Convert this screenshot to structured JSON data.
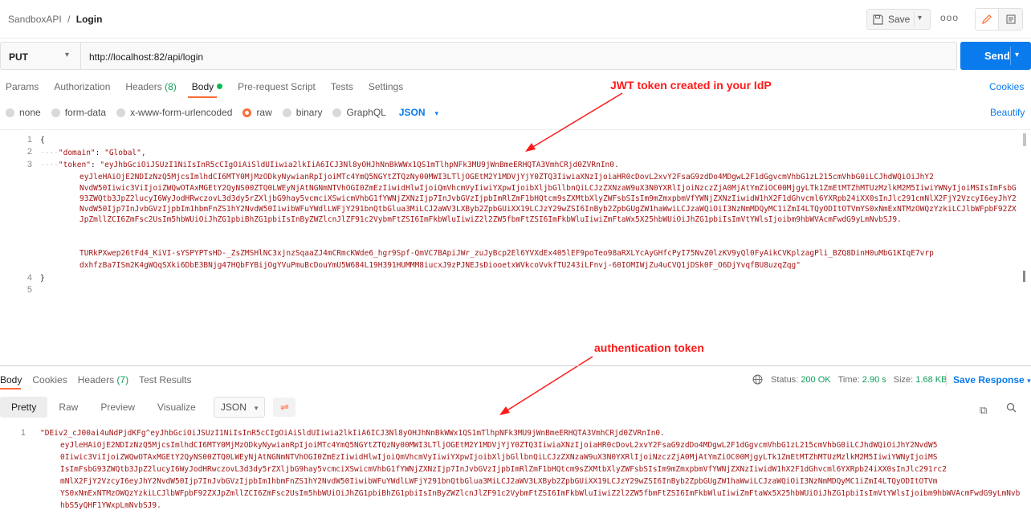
{
  "header": {
    "workspace": "SandboxAPI",
    "separator": "/",
    "request_name": "Login",
    "save_label": "Save",
    "more": "ooo"
  },
  "request": {
    "method": "PUT",
    "url": "http://localhost:82/api/login",
    "send_label": "Send"
  },
  "request_tabs": [
    {
      "label": "Params"
    },
    {
      "label": "Authorization"
    },
    {
      "label": "Headers",
      "count": "(8)"
    },
    {
      "label": "Body"
    },
    {
      "label": "Pre-request Script"
    },
    {
      "label": "Tests"
    },
    {
      "label": "Settings"
    }
  ],
  "cookies_label": "Cookies",
  "body_types": [
    {
      "label": "none"
    },
    {
      "label": "form-data"
    },
    {
      "label": "x-www-form-urlencoded"
    },
    {
      "label": "raw"
    },
    {
      "label": "binary"
    },
    {
      "label": "GraphQL"
    }
  ],
  "body_format": "JSON",
  "beautify_label": "Beautify",
  "editor": {
    "line_numbers": [
      "1",
      "2",
      "3",
      "4",
      "5"
    ],
    "open_brace": "{",
    "close_brace": "}",
    "domain_key": "\"domain\"",
    "domain_value": "\"Global\",",
    "token_key": "\"token\"",
    "token_lines": [
      "\"eyJhbGciOiJSUzI1NiIsInR5cCIgOiAiSldUIiwia2lkIiA6ICJ3Nl8yOHJhNnBkWWx1QS1mTlhpNFk3MU9jWnBmeERHQTA3VmhCRjd0ZVRnIn0.",
      "eyJleHAiOjE2NDIzNzQ5MjcsImlhdCI6MTY0MjMzODkyNywianRpIjoiMTc4YmQ5NGYtZTQzNy00MWI3LTljOGEtM2Y1MDVjYjY0ZTQ3IiwiaXNzIjoiaHR0cDovL2xvY2FsaG9zdDo4MDgwL2F1dGgvcmVhbG1zL215cmVhbG0iLCJhdWQiOiJhY2",
      "NvdW50Iiwic3ViIjoiZWQwOTAxMGEtY2QyNS00ZTQ0LWEyNjAtNGNmNTVhOGI0ZmEzIiwidHlwIjoiQmVhcmVyIiwiYXpwIjoibXljbGllbnQiLCJzZXNzaW9uX3N0YXRlIjoiNzczZjA0MjAtYmZiOC00MjgyLTk1ZmEtMTZhMTUzMzlkM2M5IiwiYWNyIjoiMSIsImFsbG93ZWQtb3JpZ2lucyI6WyJodHRwczovL3d3dy5rZXljbG9hay5vcmciXSwicmVhbG1fYWNjZXNzIjp7InJvbGVzIjpbImRlZmF1bHQtcm9sZXMtbXlyZWFsbSIsIm9mZmxpbmVfYWNjZXNzIiwidW1hX2F1dGhvcml6YXRpb24iXX0sInJlc291cmNlX2FjY2VzcyI6eyJhY2NvdW50Ijp7InJvbGVzIjpbIm1hbmFnZS1hY2NvdW50IiwibWFuYWdlLWFjY291bnQtbGlua3MiLCJ2aWV3LXByb2ZpbGUiXX19LCJzY29wZSI6InByb2ZpbGUgZW1haWwiLCJzaWQiOiI3NzNmMDQyMC1iZmI4LTQyODItOTVmYS0xNmExNTMzOWQzYzkiLCJlbWFpbF92ZXJpZmllZCI6ZmFsc2UsIm5hbWUiOiJhZG1pbiBhZG1pbiIsInByZWZlcnJlZF91c2VybmFtZSI6ImFkbWluIiwiZ2l2ZW5fbmFtZSI6ImFkbWluIiwiZmFtaWx5X25hbWUiOiJhZG1pbiIsImVtYWlsIjoibm9hbWVAcmFwdG9yLmNvbSJ9.",
      "TURkPXwep26tFd4_KiVI-sYSPYPTsHD-_ZsZMSHlNC3xjnzSqaaZJ4mCRmcKWde6_hgr9Spf-QmVC7BApiJWr_zuJyBcp2El6YVXdEx405lEF9poTeo98aRXLYcAyGHfcPyI75NvZ0lzKV9yQl0FyAikCVKplzagPli_BZQ8DinH0uMbG1KIqE7vrp",
      "dxhfzBa7ISm2K4gWQqSXki6DbE3BNjg47HQbFYBijOgYVuPmuBcDouYmU5W684L19H391HUMMM8iucxJ9zPJNEJsDiooetxWVkcoVvkfTU243iLFnvj-60IOMIWjZu4uCVQ1jDSk0F_O6DjYvqfBU8uzqZqg\""
    ]
  },
  "annotations": {
    "jwt": "JWT token created in your IdP",
    "auth": "authentication token"
  },
  "response": {
    "tabs": [
      {
        "label": "Body"
      },
      {
        "label": "Cookies"
      },
      {
        "label": "Headers",
        "count": "(7)"
      },
      {
        "label": "Test Results"
      }
    ],
    "status_label": "Status:",
    "status_value": "200 OK",
    "time_label": "Time:",
    "time_value": "2.90 s",
    "size_label": "Size:",
    "size_value": "1.68 KB",
    "save_response": "Save Response",
    "views": [
      "Pretty",
      "Raw",
      "Preview",
      "Visualize"
    ],
    "format": "JSON",
    "line_number": "1",
    "body_lines": [
      "\"DEiv2_cJ00ai4uNdPjdKFg^eyJhbGciOiJSUzI1NiIsInR5cCIgOiAiSldUIiwia2lkIiA6ICJ3Nl8yOHJhNnBkWWx1QS1mTlhpNFk3MU9jWnBmeERHQTA3VmhCRjd0ZVRnIn0.",
      "eyJleHAiOjE2NDIzNzQ5MjcsImlhdCI6MTY0MjMzODkyNywianRpIjoiMTc4YmQ5NGYtZTQzNy00MWI3LTljOGEtM2Y1MDVjYjY0ZTQ3IiwiaXNzIjoiaHR0cDovL2xvY2FsaG9zdDo4MDgwL2F1dGgvcmVhbG1zL215cmVhbG0iLCJhdWQiOiJhY2NvdW5",
      "0Iiwic3ViIjoiZWQwOTAxMGEtY2QyNS00ZTQ0LWEyNjAtNGNmNTVhOGI0ZmEzIiwidHlwIjoiQmVhcmVyIiwiYXpwIjoibXljbGllbnQiLCJzZXNzaW9uX3N0YXRlIjoiNzczZjA0MjAtYmZiOC00MjgyLTk1ZmEtMTZhMTUzMzlkM2M5IiwiYWNyIjoiMS",
      "IsImFsbG93ZWQtb3JpZ2lucyI6WyJodHRwczovL3d3dy5rZXljbG9hay5vcmciXSwicmVhbG1fYWNjZXNzIjp7InJvbGVzIjpbImRlZmF1bHQtcm9sZXMtbXlyZWFsbSIsIm9mZmxpbmVfYWNjZXNzIiwidW1hX2F1dGhvcml6YXRpb24iXX0sInJlc291rc2",
      "mNlX2FjY2VzcyI6eyJhY2NvdW50Ijp7InJvbGVzIjpbIm1hbmFnZS1hY2NvdW50IiwibWFuYWdlLWFjY291bnQtbGlua3MiLCJ2aWV3LXByb2ZpbGUiXX19LCJzY29wZSI6InByb2ZpbGUgZW1haWwiLCJzaWQiOiI3NzNmMDQyMC1iZmI4LTQyODItOTVm",
      "YS0xNmExNTMzOWQzYzkiLCJlbWFpbF92ZXJpZmllZCI6ZmFsc2UsIm5hbWUiOiJhZG1pbiBhZG1pbiIsInByZWZlcnJlZF91c2VybmFtZSI6ImFkbWluIiwiZ2l2ZW5fbmFtZSI6ImFkbWluIiwiZmFtaWx5X25hbWUiOiJhZG1pbiIsImVtYWlsIjoibm9hbWVAcmFwdG9yLmNvbSJ9",
      "hbS5yQHF1YWxpLmNvbSJ9."
    ]
  }
}
